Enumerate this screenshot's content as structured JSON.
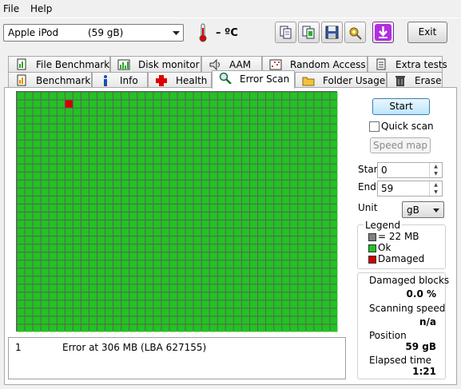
{
  "menu": {
    "file": "File",
    "help": "Help"
  },
  "drive": {
    "vendor": "Apple",
    "model": "iPod",
    "size": "(59 gB)"
  },
  "toolbar": {
    "temperature": "– ºC",
    "exit_label": "Exit",
    "icons": [
      "copy-icon",
      "copy-all-icon",
      "save-icon",
      "options-icon",
      "download-icon"
    ]
  },
  "tabs_row1": [
    "File Benchmark",
    "Disk monitor",
    "AAM",
    "Random Access",
    "Extra tests"
  ],
  "tabs_row2": [
    "Benchmark",
    "Info",
    "Health",
    "Error Scan",
    "Folder Usage",
    "Erase"
  ],
  "active_tab": "Error Scan",
  "scan_grid": {
    "columns": 40,
    "rows": 30,
    "ok_color": "#22c322",
    "damaged_color": "#d00000",
    "damaged_cells": [
      {
        "row": 1,
        "col": 6
      }
    ]
  },
  "controls": {
    "start_label": "Start",
    "quick_scan_label": "Quick scan",
    "quick_scan_checked": false,
    "speed_map_label": "Speed map",
    "start_field_label": "Start",
    "start_value": "0",
    "end_field_label": "End",
    "end_value": "59",
    "unit_label": "Unit",
    "unit_value": "gB"
  },
  "legend": {
    "title": "Legend",
    "block_size": "= 22 MB",
    "ok": "Ok",
    "damaged": "Damaged",
    "colors": {
      "block": "#808080",
      "ok": "#22c322",
      "damaged": "#d00000"
    }
  },
  "stats": {
    "damaged_blocks_label": "Damaged blocks",
    "damaged_blocks_value": "0.0 %",
    "scanning_speed_label": "Scanning speed",
    "scanning_speed_value": "n/a",
    "position_label": "Position",
    "position_value": "59 gB",
    "elapsed_time_label": "Elapsed time",
    "elapsed_time_value": "1:21"
  },
  "log": [
    {
      "index": "1",
      "message": "Error at 306 MB (LBA 627155)"
    }
  ]
}
